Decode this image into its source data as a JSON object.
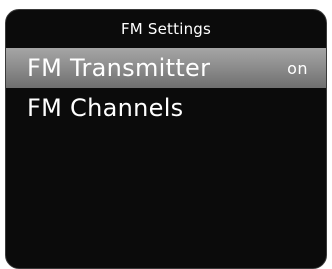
{
  "screen": {
    "title": "FM Settings"
  },
  "menu": {
    "items": [
      {
        "label": "FM Transmitter",
        "value": "on",
        "selected": true
      },
      {
        "label": "FM Channels",
        "value": "",
        "selected": false
      }
    ]
  },
  "colors": {
    "background": "#0b0b0b",
    "text": "#ffffff",
    "selection_highlight": "#8e8e8e"
  }
}
